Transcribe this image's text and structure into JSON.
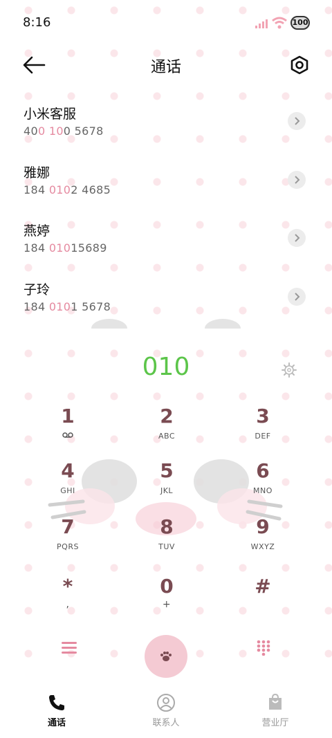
{
  "status_bar": {
    "time": "8:16",
    "battery": "100"
  },
  "header": {
    "title": "通话"
  },
  "contacts": [
    {
      "name": "小米客服",
      "num_a": "40",
      "num_hl": "0 10",
      "num_b": "0 5678"
    },
    {
      "name": "雅娜",
      "num_a": "184 ",
      "num_hl": "010",
      "num_b": "2 4685"
    },
    {
      "name": "燕婷",
      "num_a": "184 ",
      "num_hl": "010",
      "num_b": "15689"
    },
    {
      "name": "子玲",
      "num_a": "184 ",
      "num_hl": "010",
      "num_b": "1 5678"
    }
  ],
  "dialer": {
    "number": "010"
  },
  "keypad": [
    {
      "digit": "1",
      "letters": ""
    },
    {
      "digit": "2",
      "letters": "ABC"
    },
    {
      "digit": "3",
      "letters": "DEF"
    },
    {
      "digit": "4",
      "letters": "GHI"
    },
    {
      "digit": "5",
      "letters": "JKL"
    },
    {
      "digit": "6",
      "letters": "MNO"
    },
    {
      "digit": "7",
      "letters": "PQRS"
    },
    {
      "digit": "8",
      "letters": "TUV"
    },
    {
      "digit": "9",
      "letters": "WXYZ"
    },
    {
      "digit": "*",
      "letters": ","
    },
    {
      "digit": "0",
      "letters": "+"
    },
    {
      "digit": "#",
      "letters": ""
    }
  ],
  "tabs": [
    {
      "label": "通话",
      "active": true
    },
    {
      "label": "联系人",
      "active": false
    },
    {
      "label": "营业厅",
      "active": false
    }
  ],
  "colors": {
    "accent_pink": "#e58aa0",
    "dial_green": "#5cc54a",
    "digit_brown": "#7a4b52"
  }
}
